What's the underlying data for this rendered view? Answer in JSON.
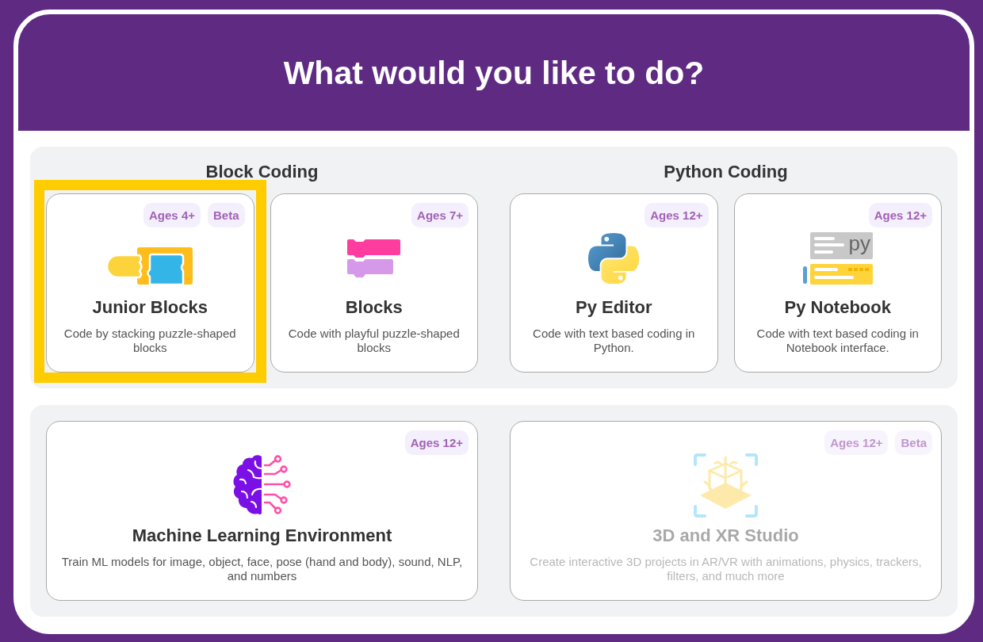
{
  "header": {
    "title": "What would you like to do?"
  },
  "panels": [
    {
      "groups": [
        {
          "heading": "Block Coding",
          "cards": [
            {
              "kind": "junior-blocks",
              "title": "Junior Blocks",
              "description": "Code by stacking puzzle-shaped blocks",
              "badges": [
                "Ages 4+",
                "Beta"
              ],
              "highlighted": true,
              "disabled": false
            },
            {
              "kind": "blocks",
              "title": "Blocks",
              "description": "Code with playful puzzle-shaped blocks",
              "badges": [
                "Ages 7+"
              ],
              "highlighted": false,
              "disabled": false
            }
          ]
        },
        {
          "heading": "Python Coding",
          "cards": [
            {
              "kind": "python",
              "title": "Py Editor",
              "description": "Code with text based coding in Python.",
              "badges": [
                "Ages 12+"
              ],
              "highlighted": false,
              "disabled": false
            },
            {
              "kind": "notebook",
              "icon_text": "py",
              "title": "Py Notebook",
              "description": "Code with text based coding in Notebook interface.",
              "badges": [
                "Ages 12+"
              ],
              "highlighted": false,
              "disabled": false
            }
          ]
        }
      ]
    },
    {
      "cards": [
        {
          "kind": "brain",
          "title": "Machine Learning Environment",
          "description": "Train ML models for image, object, face, pose (hand and body), sound, NLP, and numbers",
          "badges": [
            "Ages 12+"
          ],
          "highlighted": false,
          "disabled": false
        },
        {
          "kind": "xr",
          "title": "3D and XR Studio",
          "description": "Create interactive 3D projects in AR/VR with animations, physics, trackers, filters, and much more",
          "badges": [
            "Ages 12+",
            "Beta"
          ],
          "highlighted": false,
          "disabled": true
        }
      ]
    }
  ]
}
